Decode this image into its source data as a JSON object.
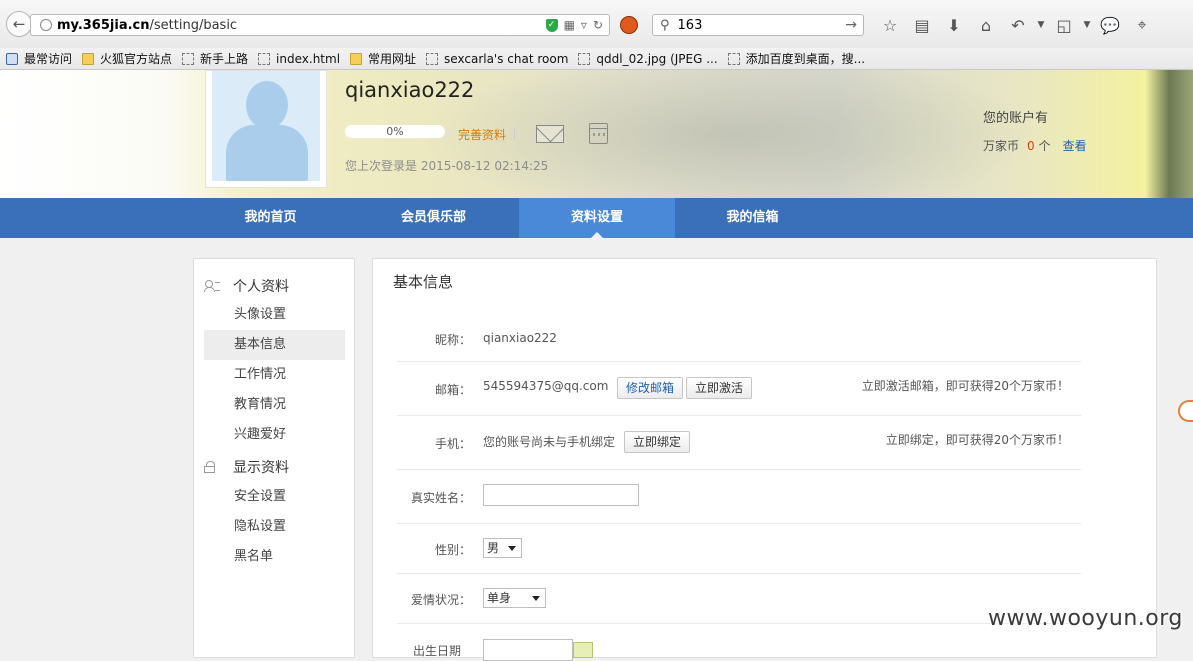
{
  "browser": {
    "url_host": "my.365jia.cn",
    "url_path": "/setting/basic",
    "search_value": "163"
  },
  "bookmarks": [
    {
      "label": "最常访问",
      "icon": "bookmarks-star-icon"
    },
    {
      "label": "火狐官方站点",
      "icon": "folder-icon"
    },
    {
      "label": "新手上路",
      "icon": "page-icon"
    },
    {
      "label": "index.html",
      "icon": "page-icon"
    },
    {
      "label": "常用网址",
      "icon": "folder-icon"
    },
    {
      "label": "sexcarla's chat room",
      "icon": "page-icon"
    },
    {
      "label": "qddl_02.jpg (JPEG ...",
      "icon": "page-icon"
    },
    {
      "label": "添加百度到桌面，搜...",
      "icon": "page-icon"
    }
  ],
  "profile": {
    "username": "qianxiao222",
    "progress_percent": 0,
    "progress_label": "0%",
    "complete_label": "完善资料",
    "last_login": "您上次登录是 2015-08-12 02:14:25",
    "account_title": "您的账户有",
    "coin_label": "万家币",
    "coin_count": "0",
    "coin_unit": "个",
    "view_label": "查看"
  },
  "nav": [
    {
      "label": "我的首页",
      "active": false
    },
    {
      "label": "会员俱乐部",
      "active": false
    },
    {
      "label": "资料设置",
      "active": true
    },
    {
      "label": "我的信箱",
      "active": false
    }
  ],
  "sidebar": {
    "group1_title": "个人资料",
    "group1_items": [
      "头像设置",
      "基本信息",
      "工作情况",
      "教育情况",
      "兴趣爱好"
    ],
    "group2_title": "显示资料",
    "group2_items": [
      "安全设置",
      "隐私设置",
      "黑名单"
    ],
    "active_item": "基本信息"
  },
  "content": {
    "title": "基本信息",
    "nickname_label": "昵称：",
    "nickname_value": "qianxiao222",
    "email_label": "邮箱：",
    "email_value": "545594375@qq.com",
    "email_edit_button": "修改邮箱",
    "email_activate_button": "立即激活",
    "email_hint": "立即激活邮箱，即可获得20个万家币！",
    "phone_label": "手机：",
    "phone_value": "您的账号尚未与手机绑定",
    "phone_bind_button": "立即绑定",
    "phone_hint": "立即绑定，即可获得20个万家币！",
    "realname_label": "真实姓名：",
    "realname_value": "",
    "gender_label": "性别：",
    "gender_value": "男",
    "love_label": "爱情状况：",
    "love_value": "单身",
    "birthday_label_partial": "出生日期"
  },
  "watermark": "www.wooyun.org",
  "colors": {
    "nav_bg": "#3a6fba",
    "nav_active": "#4a88d8",
    "link_blue": "#1f5fb6",
    "accent_orange": "#d97a00",
    "coin_red": "#e03c00"
  }
}
